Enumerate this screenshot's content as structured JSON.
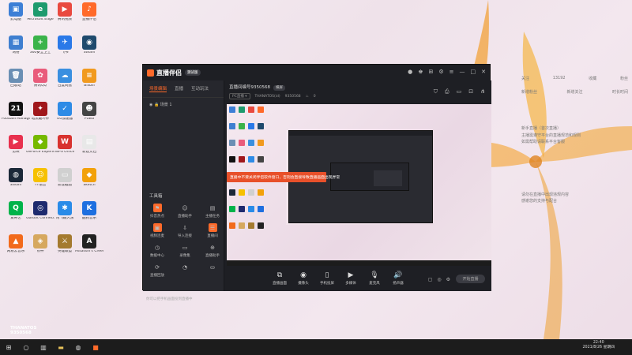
{
  "desktop_icons": [
    {
      "label": "此电脑",
      "color": "#3d7fd6",
      "glyph": "▣",
      "icon": "computer-icon"
    },
    {
      "label": "Microsoft Edge",
      "color": "#1e9b6e",
      "glyph": "e",
      "icon": "edge-icon"
    },
    {
      "label": "腾讯视频",
      "color": "#e9493f",
      "glyph": "▶",
      "icon": "image-file-icon"
    },
    {
      "label": "直播伴侣",
      "color": "#ff6a2a",
      "glyph": "♪",
      "icon": "live-companion-icon"
    },
    {
      "label": "网络",
      "color": "#3f7fd0",
      "glyph": "▦",
      "icon": "network-icon"
    },
    {
      "label": "360安全卫士",
      "color": "#3bb34a",
      "glyph": "+",
      "icon": "security-icon"
    },
    {
      "label": "飞书",
      "color": "#2a79e8",
      "glyph": "✈",
      "icon": "plane-icon"
    },
    {
      "label": "Steam",
      "color": "#1f4a6d",
      "glyph": "◉",
      "icon": "circle-app-icon"
    },
    {
      "label": "回收站",
      "color": "#6a8fb4",
      "glyph": "🗑",
      "icon": "recycle-bin-icon"
    },
    {
      "label": "腾讯QQ",
      "color": "#e95c7b",
      "glyph": "✿",
      "icon": "flower-app-icon"
    },
    {
      "label": "百度网盘",
      "color": "#3a8fe0",
      "glyph": "☁",
      "icon": "cloud-icon"
    },
    {
      "label": "Bilibili",
      "color": "#f19a1f",
      "glyph": "≡",
      "icon": "menu-app-icon"
    },
    {
      "label": "Football Manager",
      "color": "#111111",
      "glyph": "21",
      "icon": "football-icon"
    },
    {
      "label": "暗黑破坏神",
      "color": "#a0171b",
      "glyph": "✦",
      "icon": "game-icon"
    },
    {
      "label": "UU加速器",
      "color": "#2e8be6",
      "glyph": "✓",
      "icon": "shield-app-icon"
    },
    {
      "label": "PUBG",
      "color": "#444444",
      "glyph": "☻",
      "icon": "pubg-icon"
    },
    {
      "label": "剪映",
      "color": "#e8304e",
      "glyph": "▶",
      "icon": "video-editor-icon"
    },
    {
      "label": "GeForce Experience",
      "color": "#76b900",
      "glyph": "◆",
      "icon": "nvidia-icon"
    },
    {
      "label": "WPS Office",
      "color": "#d8322f",
      "glyph": "W",
      "icon": "wps-icon"
    },
    {
      "label": "新建文档",
      "color": "#e8e8e8",
      "glyph": "▤",
      "icon": "document-icon"
    },
    {
      "label": "Steam",
      "color": "#1b2838",
      "glyph": "◍",
      "icon": "steam-icon"
    },
    {
      "label": "YY语音",
      "color": "#f6c100",
      "glyph": "☺",
      "icon": "yy-icon"
    },
    {
      "label": "新建截图",
      "color": "#d0d0d0",
      "glyph": "▭",
      "icon": "screenshot-file-icon"
    },
    {
      "label": "Sketch",
      "color": "#f2a10a",
      "glyph": "◆",
      "icon": "sketch-icon"
    },
    {
      "label": "爱奇艺",
      "color": "#00b34a",
      "glyph": "Q",
      "icon": "iqiyi-icon"
    },
    {
      "label": "Ubisoft Connect",
      "color": "#1e2a6e",
      "glyph": "◎",
      "icon": "ubisoft-icon"
    },
    {
      "label": "讯飞输入法",
      "color": "#2a8be8",
      "glyph": "✱",
      "icon": "star-app-icon"
    },
    {
      "label": "酷狗音乐",
      "color": "#1e6fe0",
      "glyph": "K",
      "icon": "kugou-icon"
    },
    {
      "label": "网易云音乐",
      "color": "#f26a1b",
      "glyph": "▲",
      "icon": "music-app-icon"
    },
    {
      "label": "原神",
      "color": "#d6a85e",
      "glyph": "◈",
      "icon": "genshin-icon"
    },
    {
      "label": "英雄联盟",
      "color": "#a47a2f",
      "glyph": "⚔",
      "icon": "lol-icon"
    },
    {
      "label": "Assassin's Creed",
      "color": "#222222",
      "glyph": "A",
      "icon": "assassin-icon"
    }
  ],
  "app": {
    "title": "直播伴侣",
    "version": "测试版",
    "left_tabs": [
      "场景编辑",
      "直播",
      "互动玩法"
    ],
    "scene_label": "场景 1",
    "tools_title": "工具箱",
    "tools": [
      {
        "label": "抖音热点",
        "color": "#ff6a2a",
        "glyph": "⚑",
        "icon": "hot-icon"
      },
      {
        "label": "直播助手",
        "color": "transparent",
        "glyph": "☺",
        "icon": "assistant-icon"
      },
      {
        "label": "主播任务",
        "color": "transparent",
        "glyph": "▤",
        "icon": "task-icon"
      },
      {
        "label": "视频连麦",
        "color": "#ff6a2a",
        "glyph": "▣",
        "icon": "video-link-icon"
      },
      {
        "label": "导入连接",
        "color": "transparent",
        "glyph": "⇩",
        "icon": "import-icon"
      },
      {
        "label": "直播间",
        "color": "#ff6a2a",
        "glyph": "☰",
        "icon": "room-icon"
      },
      {
        "label": "数据中心",
        "color": "transparent",
        "glyph": "◷",
        "icon": "data-icon"
      },
      {
        "label": "录像集",
        "color": "transparent",
        "glyph": "▭",
        "icon": "record-icon"
      },
      {
        "label": "直播助手",
        "color": "transparent",
        "glyph": "⊕",
        "icon": "helper-icon"
      },
      {
        "label": "直播回放",
        "color": "transparent",
        "glyph": "⟳",
        "icon": "replay-icon"
      },
      {
        "label": "",
        "color": "transparent",
        "glyph": "◔",
        "icon": "more-tool-icon"
      },
      {
        "label": "",
        "color": "transparent",
        "glyph": "⛀",
        "icon": "extra-tool-icon"
      }
    ],
    "phone_tip": "你可以把手机画面投到直播中",
    "room_title": "直播间编号9350568",
    "room_badge": "横屏",
    "tag": "PC直播 ▾",
    "user": "THANATOS(id)",
    "user_id": "9350568",
    "fans": "0",
    "banner": "直播中不要关闭伴侣软件窗口，否则会直接导致直播画面出现异常",
    "bottom_tools": [
      {
        "label": "直播画面",
        "glyph": "⧉",
        "icon": "screen-capture-icon"
      },
      {
        "label": "摄像头",
        "glyph": "◉",
        "icon": "camera-icon"
      },
      {
        "label": "手机投屏",
        "glyph": "▯",
        "icon": "phone-cast-icon"
      },
      {
        "label": "多媒体",
        "glyph": "▶",
        "icon": "media-icon"
      },
      {
        "label": "麦克风",
        "glyph": "🎙",
        "icon": "microphone-icon"
      },
      {
        "label": "扬声器",
        "glyph": "🔊",
        "icon": "speaker-icon"
      }
    ],
    "live_button": "开始直播"
  },
  "right_panel": {
    "stats": [
      "关注",
      "13192",
      "收藏",
      "粉丝"
    ],
    "labels": [
      "新增粉丝",
      "新增关注",
      "时长时间"
    ],
    "texts": [
      "新手直播（首次直播）",
      "主播需遵守平台的直播规范和规则",
      "如需帮助请联系平台客服",
      "请勿在直播中出现违规内容",
      "感谢您的支持与配合"
    ]
  },
  "overlay_user": "THANATOS",
  "overlay_id": "9350568",
  "clock": {
    "time": "22:40",
    "date": "2021/8/26 星期四"
  }
}
